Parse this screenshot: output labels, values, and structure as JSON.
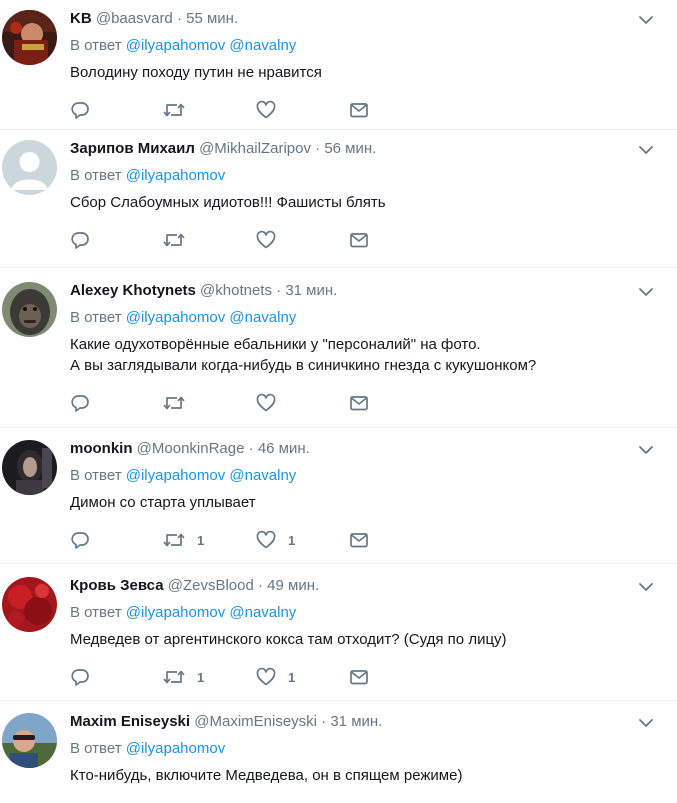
{
  "reply_prefix": "В ответ",
  "tweets": [
    {
      "name": "KB",
      "handle": "@baasvard",
      "time": "55 мин.",
      "mentions": [
        "@ilyapahomov",
        "@navalny"
      ],
      "text": [
        "Володину походу путин не нравится"
      ],
      "retweets": "",
      "likes": ""
    },
    {
      "name": "Зарипов Михаил",
      "handle": "@MikhailZaripov",
      "time": "56 мин.",
      "mentions": [
        "@ilyapahomov"
      ],
      "text": [
        "Сбор Слабоумных идиотов!!! Фашисты блять"
      ],
      "retweets": "",
      "likes": ""
    },
    {
      "name": "Alexey Khotynets",
      "handle": "@khotnets",
      "time": "31 мин.",
      "mentions": [
        "@ilyapahomov",
        "@navalny"
      ],
      "text": [
        "Какие одухотворённые ебальники у \"персоналий\" на фото.",
        "А вы заглядывали когда-нибудь в синичкино гнезда с кукушонком?"
      ],
      "retweets": "",
      "likes": ""
    },
    {
      "name": "moonkin",
      "handle": "@MoonkinRage",
      "time": "46 мин.",
      "mentions": [
        "@ilyapahomov",
        "@navalny"
      ],
      "text": [
        "Димон со старта уплывает"
      ],
      "retweets": "1",
      "likes": "1"
    },
    {
      "name": "Кровь Зевса",
      "handle": "@ZevsBlood",
      "time": "49 мин.",
      "mentions": [
        "@ilyapahomov",
        "@navalny"
      ],
      "text": [
        "Медведев от аргентинского кокса там отходит? (Судя по лицу)"
      ],
      "retweets": "1",
      "likes": "1"
    },
    {
      "name": "Maxim Eniseyski",
      "handle": "@MaximEniseyski",
      "time": "31 мин.",
      "mentions": [
        "@ilyapahomov"
      ],
      "text": [
        "Кто-нибудь, включите Медведева, он в спящем режиме)"
      ],
      "retweets": "",
      "likes": ""
    }
  ],
  "colors": {
    "link": "#1b95e0",
    "muted": "#657786",
    "text": "#14171a",
    "divider": "#e6ecf0"
  },
  "icons": {
    "reply": "reply-icon",
    "retweet": "retweet-icon",
    "like": "heart-icon",
    "dm": "envelope-icon",
    "menu": "chevron-down-icon"
  }
}
